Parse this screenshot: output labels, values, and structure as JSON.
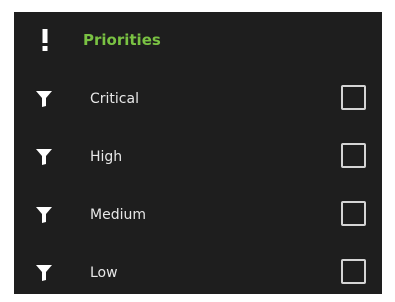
{
  "header": {
    "icon": "exclamation-icon",
    "title": "Priorities",
    "title_color": "#7ac243"
  },
  "priorities": [
    {
      "label": "Critical",
      "icon": "filter-icon",
      "checked": false
    },
    {
      "label": "High",
      "icon": "filter-icon",
      "checked": false
    },
    {
      "label": "Medium",
      "icon": "filter-icon",
      "checked": false
    },
    {
      "label": "Low",
      "icon": "filter-icon",
      "checked": false
    }
  ],
  "colors": {
    "panel_background": "#1e1e1e",
    "text": "#e8e8e8",
    "accent": "#7ac243",
    "checkbox_border": "#d4d4d4"
  }
}
